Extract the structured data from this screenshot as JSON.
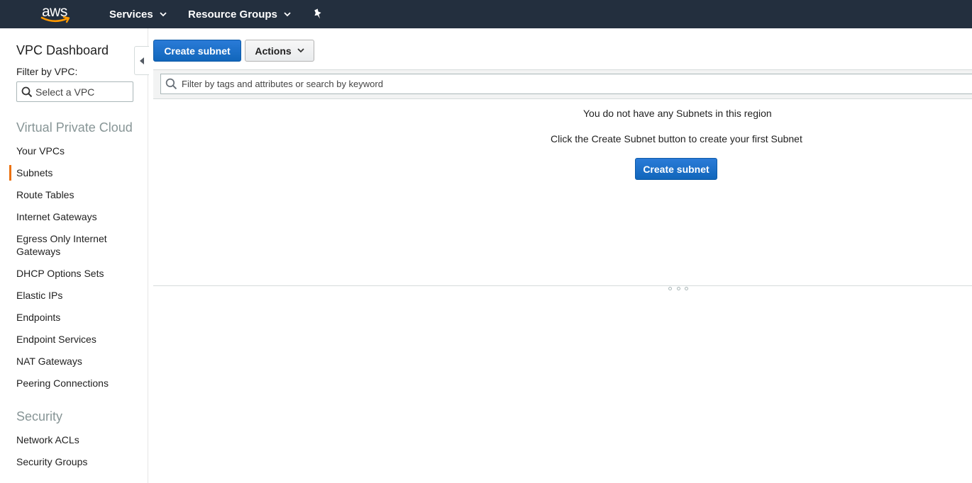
{
  "topnav": {
    "logo_text": "aws",
    "services_label": "Services",
    "resource_groups_label": "Resource Groups"
  },
  "sidebar": {
    "title": "VPC Dashboard",
    "filter_label": "Filter by VPC:",
    "vpc_select_placeholder": "Select a VPC",
    "section_vpc": "Virtual Private Cloud",
    "vpc_items": [
      "Your VPCs",
      "Subnets",
      "Route Tables",
      "Internet Gateways",
      "Egress Only Internet Gateways",
      "DHCP Options Sets",
      "Elastic IPs",
      "Endpoints",
      "Endpoint Services",
      "NAT Gateways",
      "Peering Connections"
    ],
    "active_item": "Subnets",
    "section_security": "Security",
    "security_items": [
      "Network ACLs",
      "Security Groups"
    ]
  },
  "toolbar": {
    "create_label": "Create subnet",
    "actions_label": "Actions"
  },
  "filter": {
    "placeholder": "Filter by tags and attributes or search by keyword"
  },
  "empty_state": {
    "line1": "You do not have any Subnets in this region",
    "line2": "Click the Create Subnet button to create your first Subnet",
    "button_label": "Create subnet"
  },
  "colors": {
    "nav_bg": "#232f3e",
    "primary": "#1166bb",
    "active_marker": "#ec7211",
    "section_heading": "#879596"
  },
  "icons": [
    "aws-smile-icon",
    "chevron-down-icon",
    "pin-icon",
    "search-icon",
    "collapse-left-icon",
    "resize-grip-icon"
  ]
}
